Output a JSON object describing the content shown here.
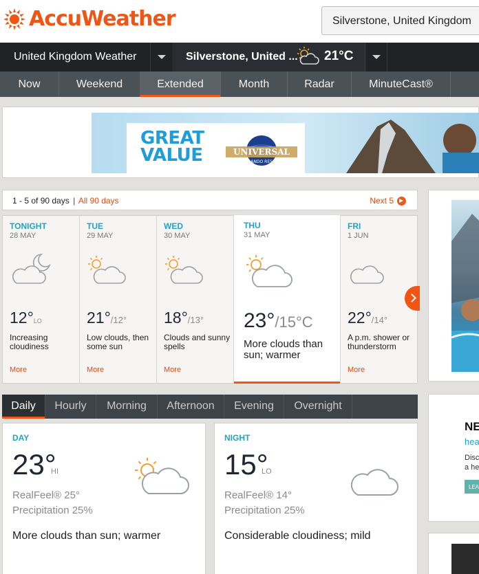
{
  "brand": {
    "name": "AccuWeather",
    "color": "#f05514"
  },
  "search": {
    "value": "Silverstone, United Kingdom"
  },
  "location_bar": {
    "country": "United Kingdom Weather",
    "city": "Silverstone, United ...",
    "temp": "21°C",
    "icon": "partly-sunny-icon"
  },
  "nav": {
    "tabs": [
      {
        "label": "Now"
      },
      {
        "label": "Weekend"
      },
      {
        "label": "Extended",
        "active": true
      },
      {
        "label": "Month"
      },
      {
        "label": "Radar"
      },
      {
        "label": "MinuteCast®"
      }
    ]
  },
  "ad": {
    "headline_1": "GREAT",
    "headline_2": "VALUE",
    "brand_1": "UNIVERSAL",
    "brand_2": "ORLANDO RESORT"
  },
  "days_header": {
    "range": "1 - 5 of 90 days",
    "separator": "|",
    "all_link": "All 90 days",
    "next": "Next 5"
  },
  "days": [
    {
      "label": "TONIGHT",
      "date": "28 MAY",
      "icon": "partly-cloudy-night-icon",
      "temp": "12°",
      "lo_label": "LO",
      "desc": "Increasing cloudiness",
      "more": "More"
    },
    {
      "label": "TUE",
      "date": "29 MAY",
      "icon": "partly-sunny-icon",
      "temp": "21°",
      "lo": "/12°",
      "desc": "Low clouds, then some sun",
      "more": "More"
    },
    {
      "label": "WED",
      "date": "30 MAY",
      "icon": "partly-sunny-icon",
      "temp": "18°",
      "lo": "/13°",
      "desc": "Clouds and sunny spells",
      "more": "More"
    },
    {
      "label": "THU",
      "date": "31 MAY",
      "icon": "partly-sunny-icon",
      "temp": "23°",
      "lo": "/15°C",
      "desc": "More clouds than sun; warmer",
      "active": true
    },
    {
      "label": "FRI",
      "date": "1 JUN",
      "icon": "cloud-icon",
      "temp": "22°",
      "lo": "/14°",
      "desc": "A p.m. shower or thunderstorm",
      "more": "More"
    }
  ],
  "period_tabs": [
    {
      "label": "Daily",
      "active": true
    },
    {
      "label": "Hourly"
    },
    {
      "label": "Morning"
    },
    {
      "label": "Afternoon"
    },
    {
      "label": "Evening"
    },
    {
      "label": "Overnight"
    }
  ],
  "day_panel": {
    "label": "DAY",
    "temp": "23°",
    "hilo": "HI",
    "realfeel": "RealFeel® 25°",
    "precip": "Precipitation 25%",
    "desc": "More clouds than sun; warmer",
    "icon": "partly-sunny-icon"
  },
  "night_panel": {
    "label": "NIGHT",
    "temp": "15°",
    "hilo": "LO",
    "realfeel": "RealFeel® 14°",
    "precip": "Precipitation 25%",
    "desc": "Considerable cloudiness; mild",
    "icon": "cloud-icon"
  },
  "side_ad": {
    "title": "NE",
    "subtitle": "hea",
    "text_1": "Disc",
    "text_2": "a he",
    "button": "LEA"
  }
}
